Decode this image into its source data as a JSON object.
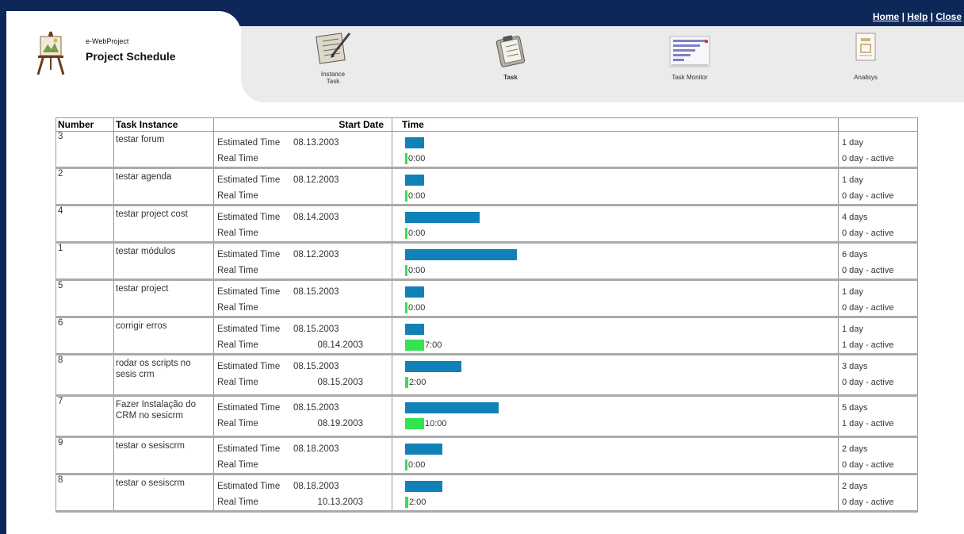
{
  "header": {
    "links": [
      "Home",
      "Help",
      "Close"
    ],
    "brand_sub": "e-WebProject",
    "brand_title": "Project Schedule"
  },
  "nav": [
    {
      "label": "Instance Task",
      "icon": "notepad-pen-icon"
    },
    {
      "label": "Task",
      "icon": "clipboard-icon"
    },
    {
      "label": "Task Monitor",
      "icon": "monitor-chart-icon"
    },
    {
      "label": "Analisys",
      "icon": "document-icon"
    }
  ],
  "table": {
    "headers": [
      "Number",
      "Task Instance",
      "Start Date",
      "Time"
    ],
    "est_label": "Estimated Time",
    "real_label": "Real Time",
    "rows": [
      {
        "number": "3",
        "task": "testar forum",
        "est_date": "08.13.2003",
        "real_date": "",
        "est_days": 1,
        "real_days": 0,
        "real_text": "0:00",
        "est_dur": "1 day",
        "real_dur": "0 day - active"
      },
      {
        "number": "2",
        "task": "testar agenda",
        "est_date": "08.12.2003",
        "real_date": "",
        "est_days": 1,
        "real_days": 0,
        "real_text": "0:00",
        "est_dur": "1 day",
        "real_dur": "0 day - active"
      },
      {
        "number": "4",
        "task": "testar project cost",
        "est_date": "08.14.2003",
        "real_date": "",
        "est_days": 4,
        "real_days": 0,
        "real_text": "0:00",
        "est_dur": "4 days",
        "real_dur": "0 day - active"
      },
      {
        "number": "1",
        "task": "testar módulos",
        "est_date": "08.12.2003",
        "real_date": "",
        "est_days": 6,
        "real_days": 0,
        "real_text": "0:00",
        "est_dur": "6 days",
        "real_dur": "0 day - active"
      },
      {
        "number": "5",
        "task": "testar project",
        "est_date": "08.15.2003",
        "real_date": "",
        "est_days": 1,
        "real_days": 0,
        "real_text": "0:00",
        "est_dur": "1 day",
        "real_dur": "0 day - active"
      },
      {
        "number": "6",
        "task": "corrigir erros",
        "est_date": "08.15.2003",
        "real_date": "08.14.2003",
        "est_days": 1,
        "real_days": 1,
        "real_text": "7:00",
        "est_dur": "1 day",
        "real_dur": "1 day - active"
      },
      {
        "number": "8",
        "task": "rodar os scripts no sesis crm",
        "est_date": "08.15.2003",
        "real_date": "08.15.2003",
        "est_days": 3,
        "real_days": 0,
        "real_text": "2:00",
        "est_dur": "3 days",
        "real_dur": "0 day - active"
      },
      {
        "number": "7",
        "task": "Fazer Instalação do CRM no sesicrm",
        "est_date": "08.15.2003",
        "real_date": "08.19.2003",
        "est_days": 5,
        "real_days": 1,
        "real_text": "10:00",
        "est_dur": "5 days",
        "real_dur": "1 day - active"
      },
      {
        "number": "9",
        "task": "testar o sesiscrm",
        "est_date": "08.18.2003",
        "real_date": "",
        "est_days": 2,
        "real_days": 0,
        "real_text": "0:00",
        "est_dur": "2 days",
        "real_dur": "0 day - active"
      },
      {
        "number": "8",
        "task": "testar o sesiscrm",
        "est_date": "08.18.2003",
        "real_date": "10.13.2003",
        "est_days": 2,
        "real_days": 0,
        "real_text": "2:00",
        "est_dur": "2 days",
        "real_dur": "0 day - active"
      }
    ]
  }
}
